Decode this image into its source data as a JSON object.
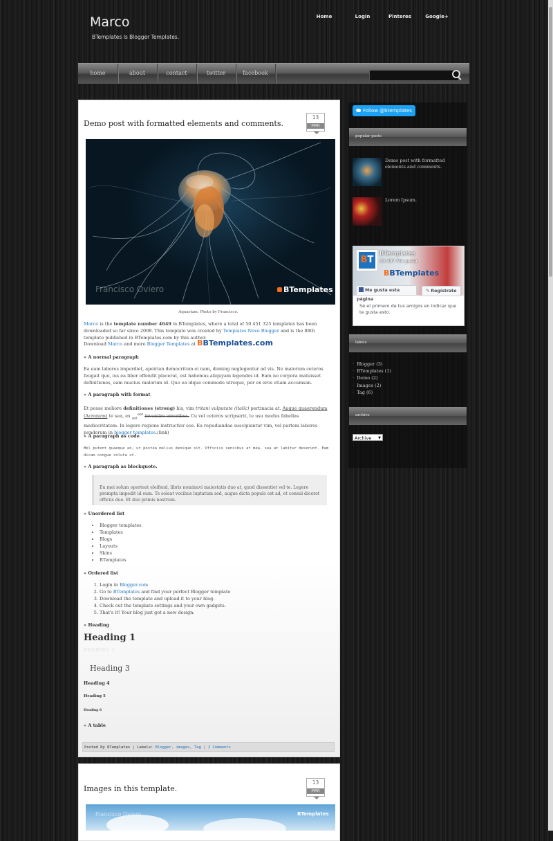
{
  "header": {
    "title": "Marco",
    "description": "BTemplates Is Blogger Templates.",
    "top_nav": [
      "Home",
      "Login",
      "Pinteres",
      "Google+"
    ]
  },
  "menu": {
    "items": [
      "home",
      "about",
      "contact",
      "twitter",
      "facebook"
    ],
    "search_placeholder": ""
  },
  "post1": {
    "title": "Demo post with formatted elements and comments.",
    "date_day": "13",
    "date_month": "MAR",
    "image_watermark": "Francisco Oviero",
    "image_logo": "BTemplates",
    "caption": "Aquarium. Photo by Francisco.",
    "intro": {
      "link1": "Marco",
      "t1": " is the ",
      "bold": "template number 4649",
      "t2": " in BTemplates, where a total of 50 451 325 templates has been downloaded so far since 2008. This template was created by ",
      "link2": "Templates Novo Blogger",
      "t3": " and is the 88th template published in BTemplates.com by this author."
    },
    "download": {
      "t1": "Download ",
      "link1": "Marco",
      "t2": " and more ",
      "link2": "Blogger Templates",
      "t3": " at ",
      "logo": "BTemplates.com"
    },
    "sec_normal": "» A normal paragraph",
    "normal_text": "Ea eam labores imperdiet, apeirian democritum ei nam, doming neglegentur ad vis. Ne malorum ceteros feugait quo, ius ea liber offendit placerat, est habemus aliquyam legendos id. Eam no corpora maluisset definitiones, eam mucius malorum id. Quo ea idque commodo utroque, per ex eros etiam accumsan.",
    "sec_format": "» A paragraph with format",
    "format": {
      "t1": "Et posse meliore ",
      "bold": "definitiones (strong)",
      "t2": " his, vim ",
      "italic": "tritani vulputate (italic)",
      "t3": " pertinacia at. ",
      "underline": "Augue quaerendum (Acronym)",
      "t4": " te sea, ex ",
      "sub": "sed",
      "sup": "sint",
      "strike": "inventire erroribus.",
      "t5": " Cu vel ceteros scripserit, te usu modus fabellas mediocritatem. In legere regione instructior eos. Ea repudiandae suscipiantur vim, vel partem labores ponderum in ",
      "link": "blogger templates",
      "t6": ".(link)"
    },
    "sec_code": "» A paragraph as code",
    "code_text": "Mel putent quaeque an, ut postea melius denique sit. Officiis sensibus at mea, sea at labitur deserunt. Eam dicam congue soluta ut.",
    "sec_quote": "» A paragraph as blockquote.",
    "quote_text": "Eu mei solum oporteat eleifend, libris nominavi maiestatis duo at, quod dissentiet vel te. Legere prompta impedit id eum. Te soleat vocibus luptatum sed, augue dicta populo est ad, et consul diceret officiis duo. Et duo primis nostrum.",
    "sec_ul": "» Unordered list",
    "ul": [
      "Blogger templates",
      "Templates",
      "Blogs",
      "Layouts",
      "Skins",
      "BTemplates"
    ],
    "sec_ol": "» Ordered list",
    "ol": {
      "i1a": "Login in ",
      "i1link": "Blogger.com",
      "i2a": "Go to ",
      "i2link": "BTemplates",
      "i2b": " and find your perfect Blogger template",
      "i3": "Download the template and upload it to your blog.",
      "i4": "Check out the template settings and your own gadgets.",
      "i5": "That's it! Your blog just got a new design."
    },
    "sec_heading": "» Heading",
    "h1": "Heading 1",
    "h2": "HEADING 2",
    "h3": "Heading 3",
    "h4": "Heading 4",
    "h5": "Heading 5",
    "h6": "Heading 6",
    "sec_table": "» A table",
    "footer": {
      "t1": "Posted By BTemplates | Labels: ",
      "label1": "Blogger",
      "label2": "images",
      "label3": "Tag",
      "sep1": ", ",
      "sep2": ", ",
      "sep3": " | ",
      "comments": "2 Comments"
    }
  },
  "post2": {
    "title": "Images in this template.",
    "date_day": "13",
    "date_month": "MAR",
    "image_watermark": "Francisco Oviero",
    "image_logo": "BTemplates"
  },
  "sidebar": {
    "twitter_button": "Follow @btemplates",
    "popular_title": "popular posts",
    "popular": [
      "Demo post with formatted elements and comments.",
      "Lorem Ipsum."
    ],
    "fb": {
      "name": "BTemplates",
      "likes": "19.497 Me gusta",
      "logo": "BTemplates",
      "like_button": "Me gusta esta página",
      "register_button": "Regístrate",
      "text": "Sé el primero de tus amigos en indicar que te gusta esto."
    },
    "labels_title": "labels",
    "labels": [
      "Blogger (3)",
      "BTemplates (1)",
      "Demo (2)",
      "Images (2)",
      "Tag (6)"
    ],
    "archive_title": "archive",
    "archive_select": "Archive"
  }
}
